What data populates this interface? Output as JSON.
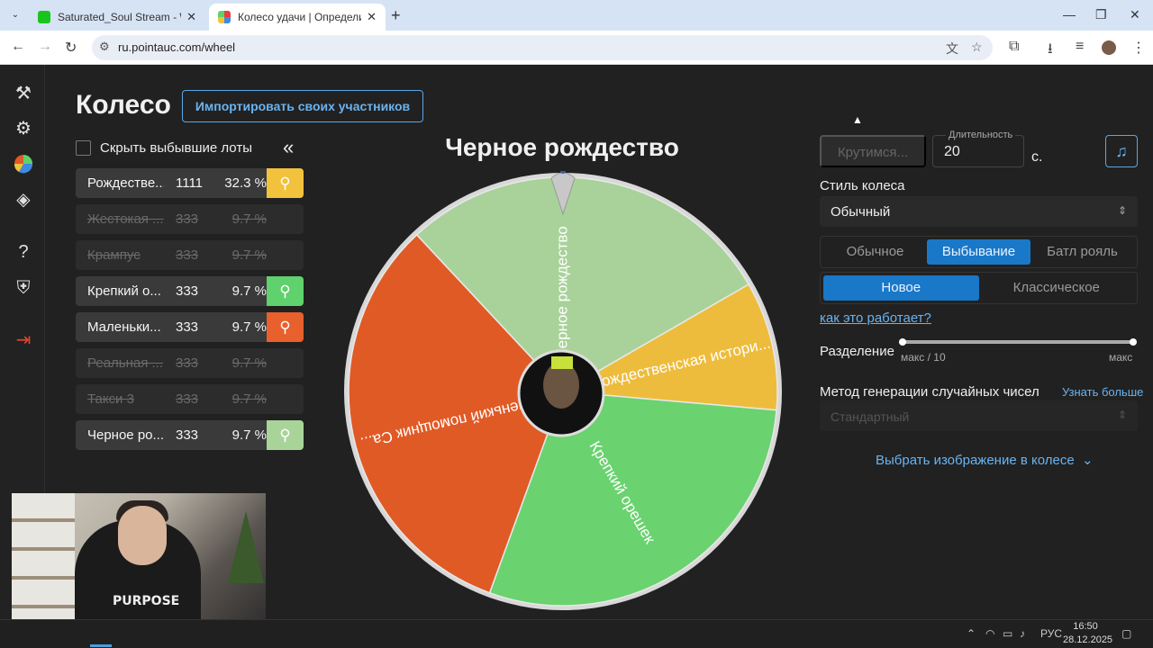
{
  "browser": {
    "tabs_menu_icon": "chevron-down-icon",
    "tabs": [
      {
        "title": "Saturated_Soul Stream - Watch",
        "favicon_color": "#18c51c",
        "active": false
      },
      {
        "title": "Колесо удачи | Определите по",
        "favicon_color": "#e7403f",
        "active": true
      }
    ],
    "new_tab": "+",
    "url": "ru.pointauc.com/wheel"
  },
  "app": {
    "page_title": "Колесо",
    "import_button": "Импортировать своих участников",
    "hide_label": "Скрыть выбывшие лоты",
    "collapse_icon": "«",
    "lots": [
      {
        "name": "Рождестве...",
        "amount": "1111",
        "percent": "32.3 %",
        "state": "active",
        "color": "#f2c23c"
      },
      {
        "name": "Жестокая ...",
        "amount": "333",
        "percent": "9.7 %",
        "state": "out",
        "color": ""
      },
      {
        "name": "Крампус",
        "amount": "333",
        "percent": "9.7 %",
        "state": "out",
        "color": ""
      },
      {
        "name": "Крепкий о...",
        "amount": "333",
        "percent": "9.7 %",
        "state": "active",
        "color": "#5fd16d"
      },
      {
        "name": "Маленьки...",
        "amount": "333",
        "percent": "9.7 %",
        "state": "active",
        "color": "#e8602c"
      },
      {
        "name": "Реальная ...",
        "amount": "333",
        "percent": "9.7 %",
        "state": "out",
        "color": ""
      },
      {
        "name": "Такси 3",
        "amount": "333",
        "percent": "9.7 %",
        "state": "out",
        "color": ""
      },
      {
        "name": "Черное ро...",
        "amount": "333",
        "percent": "9.7 %",
        "state": "active",
        "color": "#a8d49a"
      }
    ],
    "wheel": {
      "title": "Черное рождество",
      "segments": [
        {
          "label": "Черное рождество",
          "color": "#a9d29a"
        },
        {
          "label": "Рождественская истори...",
          "color": "#eebc3c"
        },
        {
          "label": "Крепкий орешек",
          "color": "#6ad26f"
        },
        {
          "label": "Маленький помощник Са...",
          "color": "#e05a26"
        }
      ]
    },
    "controls": {
      "spin_button": "Крутимся...",
      "duration_label": "Длительность",
      "duration_value": "20",
      "duration_unit": "с.",
      "music_icon": "music-note-icon",
      "style_label": "Стиль колеса",
      "style_value": "Обычный",
      "mode_options": [
        "Обычное",
        "Выбывание",
        "Батл рояль"
      ],
      "mode_selected": "Выбывание",
      "variant_options": [
        "Новое",
        "Классическое"
      ],
      "variant_selected": "Новое",
      "how_link": "как это работает?",
      "split_label": "Разделение",
      "split_min_label": "макс / 10",
      "split_max_label": "макс",
      "rng_label": "Метод генерации случайных чисел",
      "learn_more": "Узнать больше",
      "rng_value": "Стандартный",
      "choose_image": "Выбрать изображение в колесе"
    }
  },
  "webcam": {
    "shirt_text": "PURPOSE"
  },
  "taskbar": {
    "lang": "РУС",
    "time": "16:50",
    "date": "28.12.2025"
  }
}
